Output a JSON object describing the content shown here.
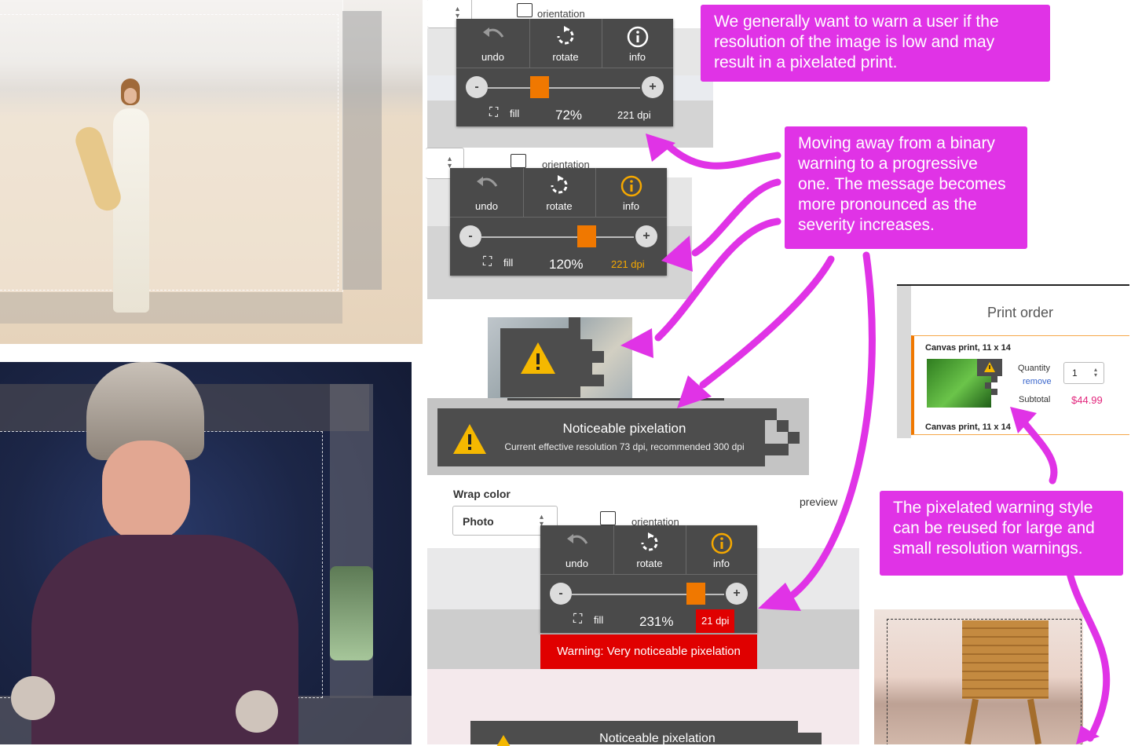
{
  "callouts": {
    "top": "We generally want to warn a user if the resolution of the image is low and may result in a pixelated print.",
    "middle": "Moving away from a binary warning to a progressive one. The message becomes more pronounced as the severity increases.",
    "bottom": "The pixelated warning style can be reused for large and small resolution warnings."
  },
  "orientation_label": "orientation",
  "toolbars": [
    {
      "undo": "undo",
      "rotate": "rotate",
      "info": "info",
      "fill": "fill",
      "zoom": "72%",
      "dpi": "221 dpi",
      "slider_level": 0.42,
      "info_color": "#ffffff",
      "dpi_color": "#ffffff"
    },
    {
      "undo": "undo",
      "rotate": "rotate",
      "info": "info",
      "fill": "fill",
      "zoom": "120%",
      "dpi": "221 dpi",
      "slider_level": 0.62,
      "info_color": "#f5a800",
      "dpi_color": "#f5a800"
    },
    {
      "undo": "undo",
      "rotate": "rotate",
      "info": "info",
      "fill": "fill",
      "zoom": "231%",
      "dpi": "21 dpi",
      "slider_level": 0.86,
      "info_color": "#f5a800",
      "dpi_color": "#ffffff",
      "dpi_bg": "#e00000",
      "warning": "Warning: Very noticeable pixelation"
    }
  ],
  "pixelation_banner": {
    "title": "Noticeable pixelation",
    "detail": "Current effective resolution 73 dpi, recommended 300 dpi"
  },
  "bottom_banner": {
    "title": "Noticeable pixelation"
  },
  "wrap": {
    "label": "Wrap color",
    "value": "Photo",
    "preview": "preview"
  },
  "print_order": {
    "title": "Print order",
    "item_title": "Canvas print, 11 x 14",
    "quantity_label": "Quantity",
    "quantity_value": "1",
    "remove": "remove",
    "subtotal_label": "Subtotal",
    "subtotal_value": "$44.99",
    "next_item_title": "Canvas print, 11 x 14"
  },
  "colors": {
    "callout": "#e033e6",
    "toolbar": "#4a4a4a",
    "slider_thumb": "#f07800",
    "warning_red": "#e00000",
    "warning_amber": "#f5a800",
    "price": "#e2267c"
  }
}
